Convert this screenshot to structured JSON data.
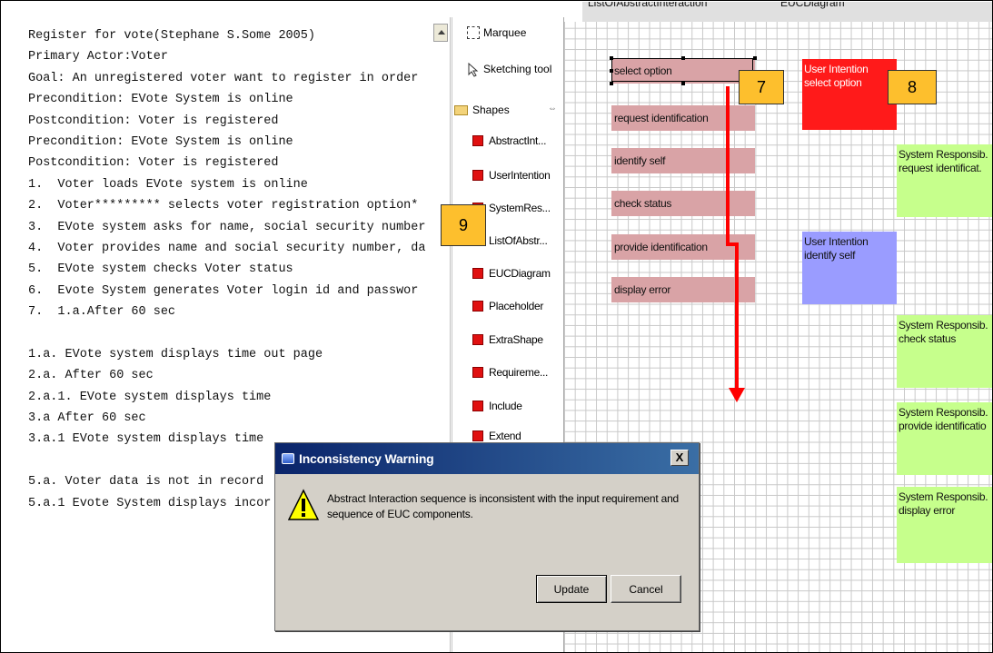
{
  "requirement": {
    "lines": [
      "Register for vote(Stephane S.Some 2005)",
      "Primary Actor:Voter",
      "Goal: An unregistered voter want to register in order",
      "Precondition: EVote System is online",
      "Postcondition: Voter is registered",
      "Precondition: EVote System is online",
      "Postcondition: Voter is registered",
      "1.  Voter loads EVote system is online",
      "2.  Voter********* selects voter registration option*",
      "3.  EVote system asks for name, social security number",
      "4.  Voter provides name and social security number, da",
      "5.  EVote system checks Voter status",
      "6.  Evote System generates Voter login id and passwor",
      "7.  1.a.After 60 sec",
      "",
      "1.a. EVote system displays time out page",
      "2.a. After 60 sec",
      "2.a.1. EVote system displays time",
      "3.a After 60 sec",
      "3.a.1 EVote system displays time",
      "",
      "5.a. Voter data is not in record",
      "5.a.1 Evote System displays incor"
    ]
  },
  "palette": {
    "tools": [
      {
        "label": "Marquee",
        "icon": "marquee-icon"
      },
      {
        "label": "Sketching tool",
        "icon": "arrow-cursor-icon"
      }
    ],
    "shapes_header": "Shapes",
    "collapse_symbol": "⇔",
    "items": [
      "AbstractInt...",
      "UserIntention",
      "SystemRes...",
      "ListOfAbstr...",
      "EUCDiagram",
      "Placeholder",
      "ExtraShape",
      "Requireme...",
      "Include",
      "Extend"
    ]
  },
  "canvas": {
    "tabs": [
      "ListOfAbstractInteraction",
      "EUCDiagram"
    ],
    "abstract_interactions": [
      "select option",
      "request identification",
      "identify self",
      "check status",
      "provide identification",
      "display error"
    ],
    "user_intentions": [
      {
        "title": "User Intention",
        "text": "select option"
      },
      {
        "title": "User Intention",
        "text": "identify self"
      }
    ],
    "system_responsibilities": [
      {
        "title": "System Responsib.",
        "text": "request identificat."
      },
      {
        "title": "System Responsib.",
        "text": "check status"
      },
      {
        "title": "System Responsib.",
        "text": "provide identificatio"
      },
      {
        "title": "System Responsib.",
        "text": "display error"
      }
    ],
    "badges": [
      "7",
      "8",
      "9"
    ],
    "colors": {
      "abstract_interaction": "#d9a3a6",
      "user_intention_active": "#ff1a1a",
      "user_intention": "#9a9cff",
      "system_responsibility": "#c6ff8c",
      "badge": "#fdbf2d",
      "arrow": "#ff0000"
    }
  },
  "dialog": {
    "title": "Inconsistency Warning",
    "close_symbol": "X",
    "message": "Abstract Interaction sequence is inconsistent with the input requirement and sequence of EUC components.",
    "update_label": "Update",
    "cancel_label": "Cancel",
    "icon": "warning-icon"
  }
}
